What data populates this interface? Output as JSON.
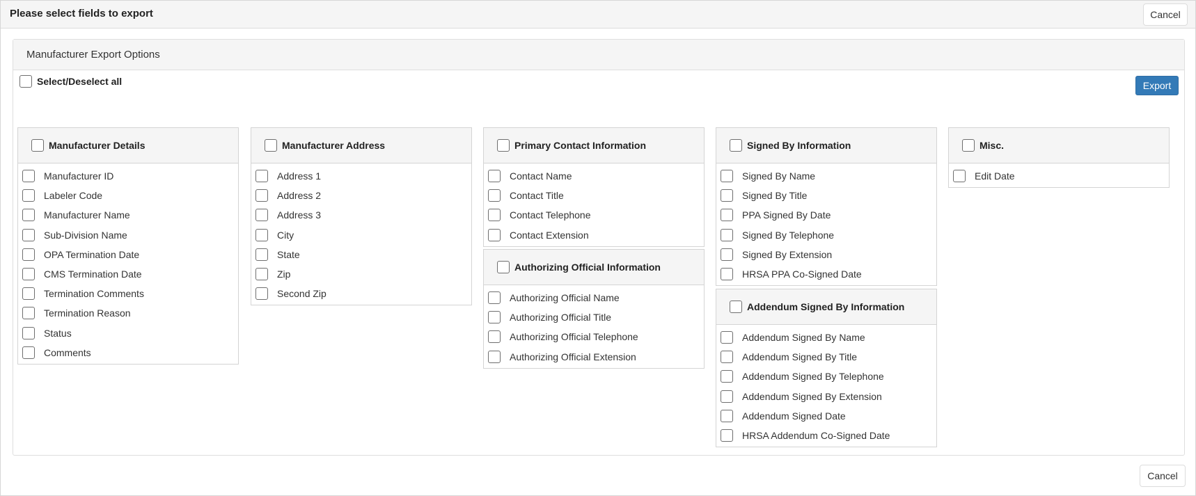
{
  "dialog": {
    "title": "Please select fields to export",
    "cancel_label": "Cancel"
  },
  "panel": {
    "title": "Manufacturer Export Options",
    "select_all_label": "Select/Deselect all",
    "export_label": "Export"
  },
  "groups": {
    "manufacturer_details": {
      "title": "Manufacturer Details",
      "items": [
        "Manufacturer ID",
        "Labeler Code",
        "Manufacturer Name",
        "Sub-Division Name",
        "OPA Termination Date",
        "CMS Termination Date",
        "Termination Comments",
        "Termination Reason",
        "Status",
        "Comments"
      ]
    },
    "manufacturer_address": {
      "title": "Manufacturer Address",
      "items": [
        "Address 1",
        "Address 2",
        "Address 3",
        "City",
        "State",
        "Zip",
        "Second Zip"
      ]
    },
    "primary_contact": {
      "title": "Primary Contact Information",
      "items": [
        "Contact Name",
        "Contact Title",
        "Contact Telephone",
        "Contact Extension"
      ]
    },
    "authorizing_official": {
      "title": "Authorizing Official Information",
      "items": [
        "Authorizing Official Name",
        "Authorizing Official Title",
        "Authorizing Official Telephone",
        "Authorizing Official Extension"
      ]
    },
    "signed_by": {
      "title": "Signed By Information",
      "items": [
        "Signed By Name",
        "Signed By Title",
        "PPA Signed By Date",
        "Signed By Telephone",
        "Signed By Extension",
        "HRSA PPA Co-Signed Date"
      ]
    },
    "addendum_signed_by": {
      "title": "Addendum Signed By Information",
      "items": [
        "Addendum Signed By Name",
        "Addendum Signed By Title",
        "Addendum Signed By Telephone",
        "Addendum Signed By Extension",
        "Addendum Signed Date",
        "HRSA Addendum Co-Signed Date"
      ]
    },
    "misc": {
      "title": "Misc.",
      "items": [
        "Edit Date"
      ]
    }
  }
}
